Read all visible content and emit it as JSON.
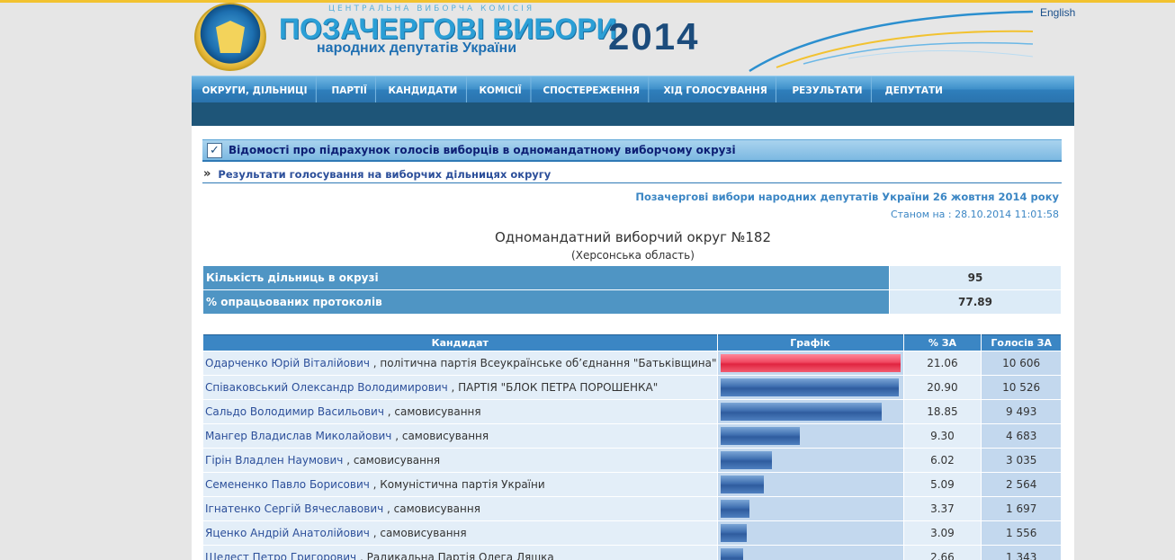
{
  "header": {
    "cvk_label": "ЦЕНТРАЛЬНА ВИБОРЧА КОМІСІЯ",
    "title": "ПОЗАЧЕРГОВІ ВИБОРИ",
    "subtitle": "народних депутатів України",
    "year": "2014",
    "language_link": "English"
  },
  "nav": {
    "items": [
      {
        "label": "ОКРУГИ, ДІЛЬНИЦІ"
      },
      {
        "label": "ПАРТІЇ"
      },
      {
        "label": "КАНДИДАТИ"
      },
      {
        "label": "КОМІСІЇ"
      },
      {
        "label": "СПОСТЕРЕЖЕННЯ"
      },
      {
        "label": "ХІД ГОЛОСУВАННЯ"
      },
      {
        "label": "РЕЗУЛЬТАТИ"
      },
      {
        "label": "ДЕПУТАТИ"
      }
    ]
  },
  "section": {
    "title": "Відомості про підрахунок голосів виборців в одномандатному виборчому окрузі",
    "breadcrumb_arrow": "»",
    "breadcrumb_link": "Результати голосування на виборчих дільницях округу"
  },
  "election_title": "Позачергові вибори народних депутатів України 26 жовтня 2014 року",
  "as_of": "Станом на : 28.10.2014 11:01:58",
  "district": {
    "name": "Одномандатний виборчий округ №182",
    "region": "(Херсонська область)"
  },
  "stats": [
    {
      "label": "Кількість дільниць в окрузі",
      "value": "95"
    },
    {
      "label": "% опрацьованих протоколів",
      "value": "77.89"
    }
  ],
  "results": {
    "headers": {
      "candidate": "Кандидат",
      "graph": "Графік",
      "pct": "% ЗА",
      "votes": "Голосів ЗА"
    },
    "max_pct": 21.06,
    "accent_color": "#e02440",
    "bar_color": "#3e6eb0",
    "rows": [
      {
        "name": "Одарченко Юрій Віталійович",
        "party": " , політична партія Всеукраїнське об’єднання \"Батьківщина\"",
        "pct": 21.06,
        "pct_text": "21.06",
        "votes": "10 606",
        "highlight": true
      },
      {
        "name": "Співаковський Олександр Володимирович",
        "party": " , ПАРТІЯ \"БЛОК ПЕТРА ПОРОШЕНКА\"",
        "pct": 20.9,
        "pct_text": "20.90",
        "votes": "10 526",
        "highlight": false
      },
      {
        "name": "Сальдо Володимир Васильович",
        "party": " , самовисування",
        "pct": 18.85,
        "pct_text": "18.85",
        "votes": "9 493",
        "highlight": false
      },
      {
        "name": "Мангер Владислав Миколайович",
        "party": " , самовисування",
        "pct": 9.3,
        "pct_text": "9.30",
        "votes": "4 683",
        "highlight": false
      },
      {
        "name": "Гірін Владлен Наумович",
        "party": " , самовисування",
        "pct": 6.02,
        "pct_text": "6.02",
        "votes": "3 035",
        "highlight": false
      },
      {
        "name": "Семененко Павло Борисович",
        "party": " , Комуністична партія України",
        "pct": 5.09,
        "pct_text": "5.09",
        "votes": "2 564",
        "highlight": false
      },
      {
        "name": "Ігнатенко Сергій Вячеславович",
        "party": " , самовисування",
        "pct": 3.37,
        "pct_text": "3.37",
        "votes": "1 697",
        "highlight": false
      },
      {
        "name": "Яценко Андрій Анатолійович",
        "party": " , самовисування",
        "pct": 3.09,
        "pct_text": "3.09",
        "votes": "1 556",
        "highlight": false
      },
      {
        "name": "Шелест Петро Григорович",
        "party": " , Радикальна Партія Олега Ляшка",
        "pct": 2.66,
        "pct_text": "2.66",
        "votes": "1 343",
        "highlight": false
      }
    ]
  }
}
